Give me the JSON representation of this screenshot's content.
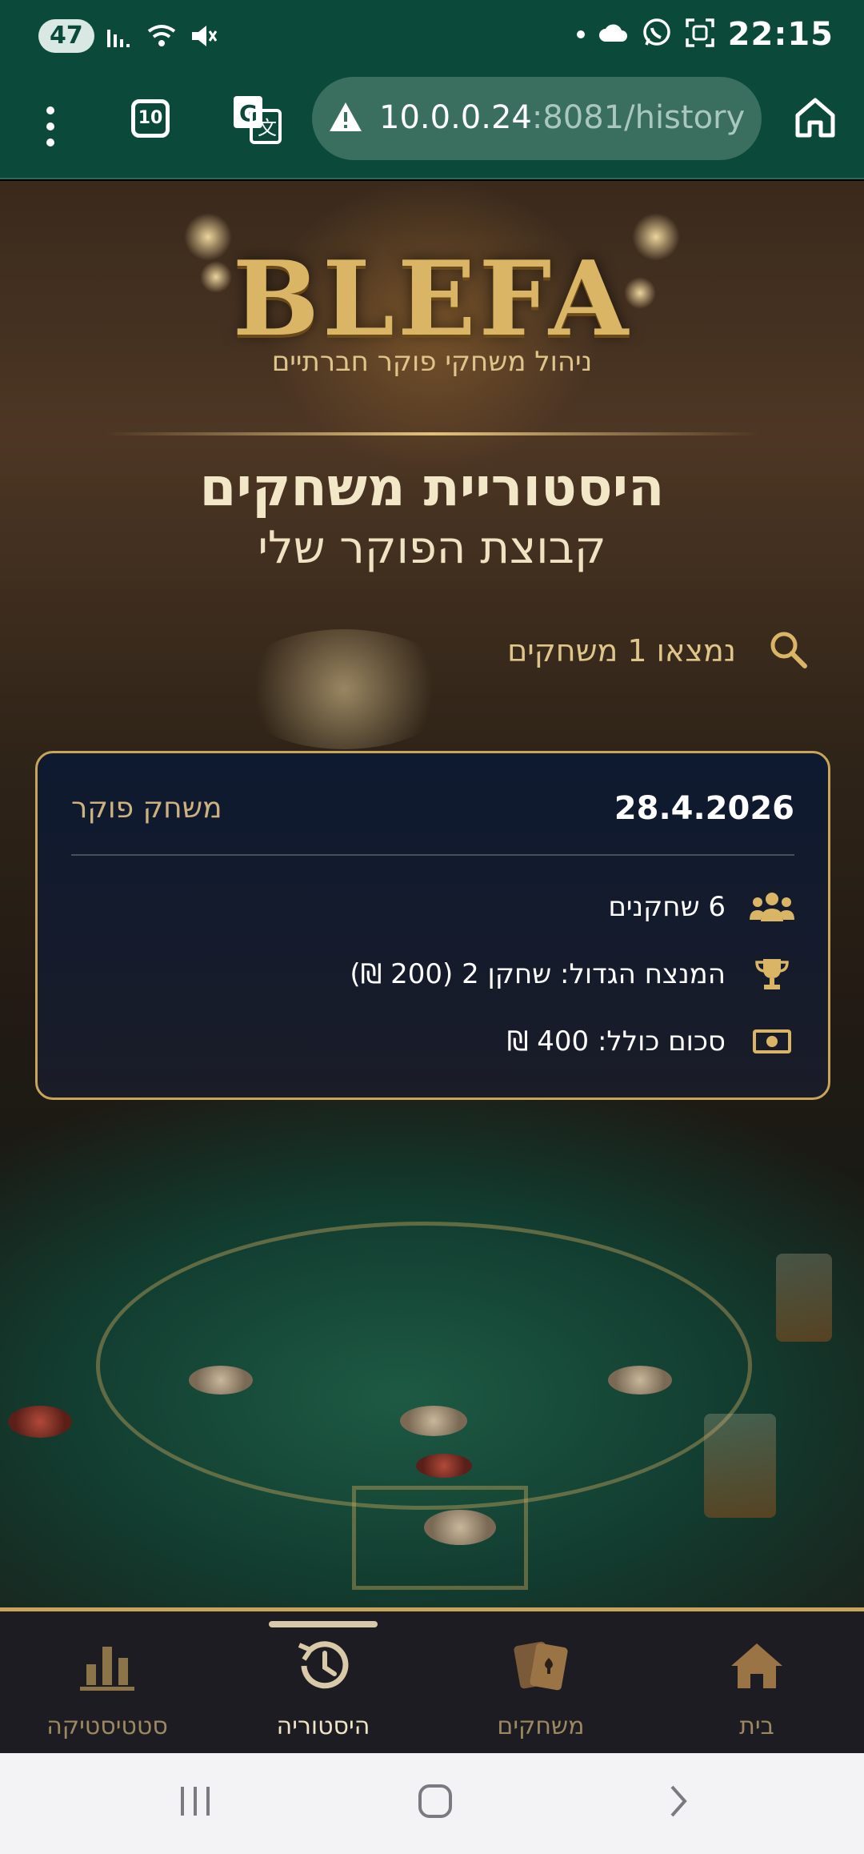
{
  "status_bar": {
    "battery": "47",
    "time": "22:15"
  },
  "browser": {
    "tab_count": "10",
    "url_host": "10.0.0.24",
    "url_path": ":8081/history"
  },
  "brand": {
    "logo": "BLEFA",
    "tagline": "ניהול משחקי פוקר חברתיים"
  },
  "page": {
    "title": "היסטוריית משחקים",
    "subtitle": "קבוצת הפוקר שלי",
    "found_text": "נמצאו 1 משחקים"
  },
  "games": [
    {
      "date": "28.4.2026",
      "type": "משחק פוקר",
      "players": "6 שחקנים",
      "winner": "המנצח הגדול: שחקן 2 (200 ₪)",
      "total": "סכום כולל: 400 ₪"
    }
  ],
  "bottom_nav": [
    {
      "label": "סטטיסטיקה",
      "icon": "bar-chart-icon"
    },
    {
      "label": "היסטוריה",
      "icon": "history-icon",
      "active": true
    },
    {
      "label": "משחקים",
      "icon": "cards-icon"
    },
    {
      "label": "בית",
      "icon": "home-icon"
    }
  ],
  "colors": {
    "browser_green": "#0b4a3a",
    "gold": "#c8a55a",
    "card_bg": "#0e1a30",
    "nav_bg": "#1c1c22"
  }
}
